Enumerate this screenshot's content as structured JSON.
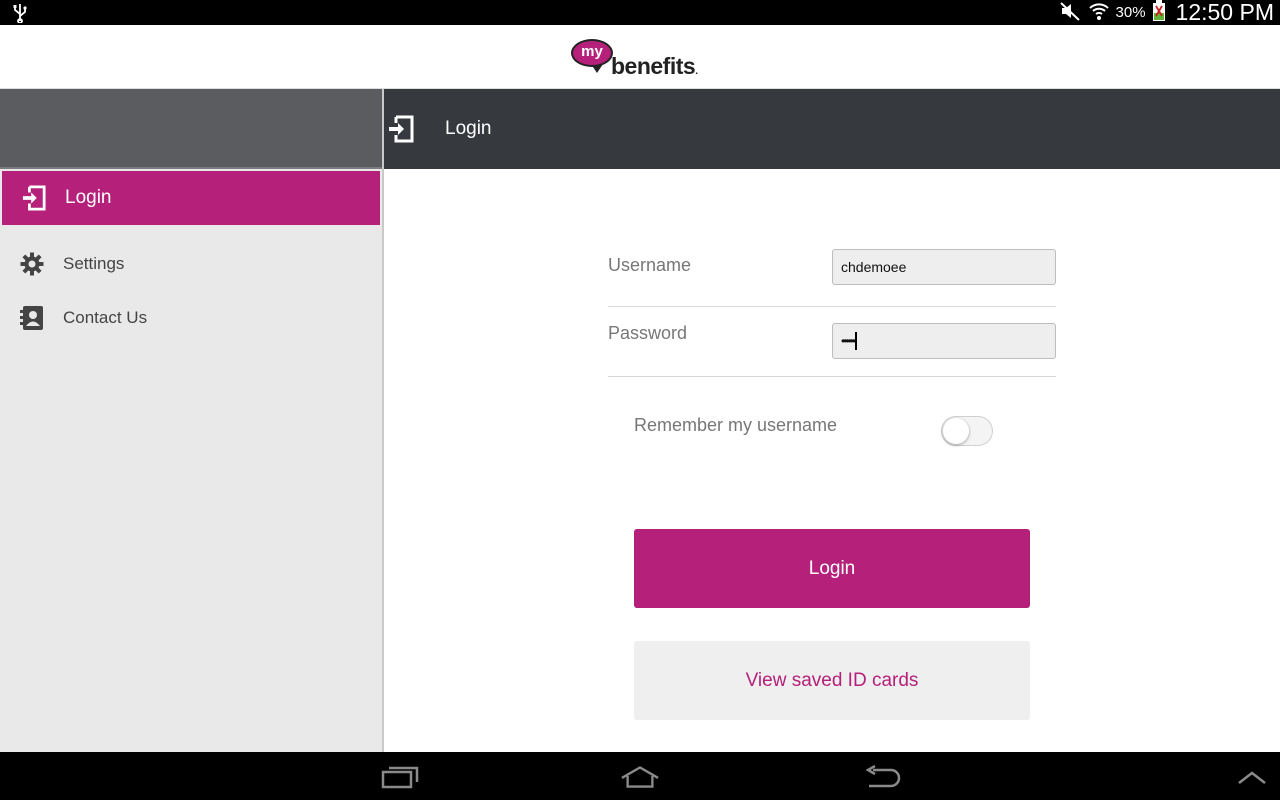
{
  "status_bar": {
    "battery_percent": "30%",
    "time": "12:50 PM",
    "icons": [
      "usb-icon",
      "mute-icon",
      "wifi-icon",
      "battery-icon"
    ]
  },
  "logo": {
    "bubble_text": "my",
    "word_text": "benefits",
    "trademark": ".",
    "brand_color": "#b5207a"
  },
  "sidebar": {
    "items": [
      {
        "label": "Login",
        "icon": "login-icon",
        "active": true
      },
      {
        "label": "Settings",
        "icon": "gear-icon",
        "active": false
      },
      {
        "label": "Contact Us",
        "icon": "contacts-icon",
        "active": false
      }
    ]
  },
  "header": {
    "title": "Login",
    "icon": "login-icon"
  },
  "form": {
    "username_label": "Username",
    "username_value": "chdemoee",
    "password_label": "Password",
    "password_value": "••••••",
    "remember_label": "Remember my username",
    "remember_on": false,
    "login_button": "Login",
    "saved_cards_button": "View saved ID cards"
  },
  "nav_bar": {
    "buttons": [
      "recent-apps-icon",
      "home-icon",
      "back-icon",
      "up-chevron-icon"
    ]
  },
  "colors": {
    "accent": "#b5207a",
    "header_dark": "#36393e",
    "sidebar_header": "#5b5c60",
    "sidebar_bg": "#e9e9e9"
  }
}
